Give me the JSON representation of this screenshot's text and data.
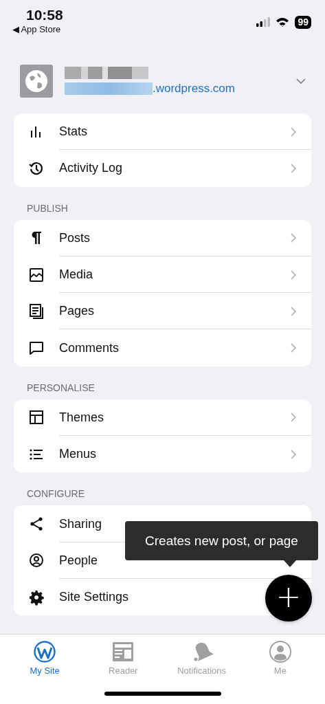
{
  "status_bar": {
    "time": "10:58",
    "back_glyph": "◀",
    "back_label": "App Store",
    "battery": "99"
  },
  "site": {
    "domain": ".wordpress.com",
    "expanded": false
  },
  "sections": [
    {
      "items": [
        {
          "label": "Stats",
          "chevron": true
        },
        {
          "label": "Activity Log",
          "chevron": true
        }
      ]
    },
    {
      "title": "PUBLISH",
      "items": [
        {
          "label": "Posts",
          "chevron": true
        },
        {
          "label": "Media",
          "chevron": true
        },
        {
          "label": "Pages",
          "chevron": true
        },
        {
          "label": "Comments",
          "chevron": true
        }
      ]
    },
    {
      "title": "PERSONALISE",
      "items": [
        {
          "label": "Themes",
          "chevron": true
        },
        {
          "label": "Menus",
          "chevron": true
        }
      ]
    },
    {
      "title": "CONFIGURE",
      "items": [
        {
          "label": "Sharing",
          "chevron": false
        },
        {
          "label": "People",
          "chevron": false
        },
        {
          "label": "Site Settings",
          "chevron": false
        }
      ]
    }
  ],
  "tooltip": "Creates new post, or page",
  "fab": {
    "glyph": "+"
  },
  "tabs": [
    {
      "label": "My Site",
      "selected": true
    },
    {
      "label": "Reader",
      "selected": false
    },
    {
      "label": "Notifications",
      "selected": false
    },
    {
      "label": "Me",
      "selected": false
    }
  ]
}
